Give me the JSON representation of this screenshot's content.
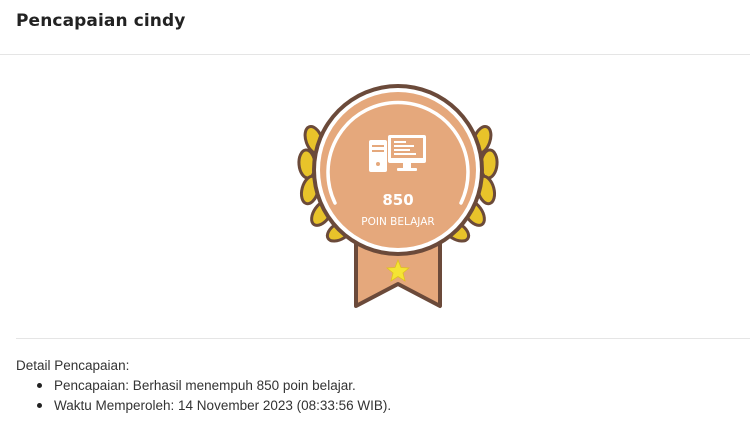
{
  "header": {
    "title": "Pencapaian cindy"
  },
  "badge": {
    "points": "850",
    "label": "POIN BELAJAR",
    "icon": "computer-icon",
    "colors": {
      "badge_fill": "#E5A87C",
      "outline": "#6B4A3A",
      "laurel": "#E8C32A",
      "star": "#F5E433",
      "ring": "#FFFFFF"
    }
  },
  "details": {
    "heading": "Detail Pencapaian:",
    "items": [
      "Pencapaian: Berhasil menempuh 850 poin belajar.",
      "Waktu Memperoleh: 14 November 2023 (08:33:56 WIB)."
    ]
  }
}
